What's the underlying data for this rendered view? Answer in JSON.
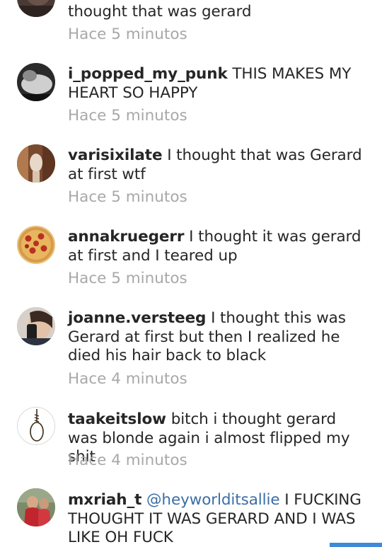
{
  "comments": [
    {
      "username": "",
      "mention": "",
      "text": "thought that was gerard",
      "time": "Hace 5 minutos",
      "avatar": "avatar-dark-photo"
    },
    {
      "username": "i_popped_my_punk",
      "mention": "",
      "text": "THIS MAKES MY HEART SO HAPPY",
      "time": "Hace 5 minutos",
      "avatar": "avatar-bw-photo"
    },
    {
      "username": "varisixilate",
      "mention": "",
      "text": "I thought that was Gerard at first wtf",
      "time": "Hace 5 minutos",
      "avatar": "avatar-selfie-photo"
    },
    {
      "username": "annakruegerr",
      "mention": "",
      "text": "I thought it was gerard at first and I teared up",
      "time": "Hace 5 minutos",
      "avatar": "avatar-pizza-photo"
    },
    {
      "username": "joanne.versteeg",
      "mention": "",
      "text": "I thought this was Gerard at first but then I realized he died his hair back to black",
      "time": "Hace 4 minutos",
      "avatar": "avatar-mirror-selfie-photo"
    },
    {
      "username": "taakeitslow",
      "mention": "",
      "text": "bitch i thought gerard was blonde again i almost flipped my shit",
      "time": "Hace 4 minutos",
      "avatar": "avatar-noose-drawing"
    },
    {
      "username": "mxriah_t",
      "mention": "@heyworlditsallie",
      "text": "I FUCKING THOUGHT IT WAS GERARD AND I WAS LIKE OH FUCK",
      "time": "",
      "avatar": "avatar-red-dress-photo"
    }
  ],
  "colors": {
    "username": "#262626",
    "text": "#262626",
    "timestamp": "#a8a8a8",
    "mention": "#3b6ea5",
    "accent_bar": "#3f8ad8"
  }
}
